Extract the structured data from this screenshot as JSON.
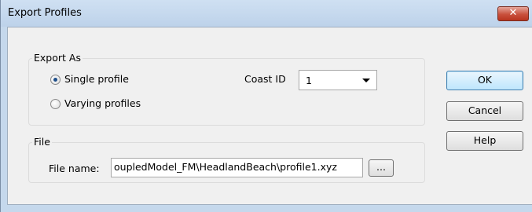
{
  "window": {
    "title": "Export Profiles",
    "close_glyph": "✕"
  },
  "export_as": {
    "group_label": "Export As",
    "options": [
      {
        "label": "Single profile",
        "selected": true
      },
      {
        "label": "Varying profiles",
        "selected": false
      }
    ],
    "coast_id_label": "Coast ID",
    "coast_id_value": "1"
  },
  "file": {
    "group_label": "File",
    "file_name_label": "File name:",
    "file_name_value": "oupledModel_FM\\HeadlandBeach\\profile1.xyz",
    "browse_label": "..."
  },
  "buttons": {
    "ok": "OK",
    "cancel": "Cancel",
    "help": "Help"
  }
}
